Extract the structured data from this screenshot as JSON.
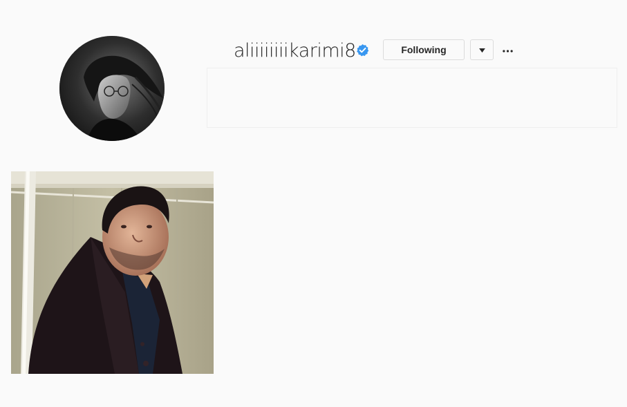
{
  "profile": {
    "username": "aliiiiiiiikarimi8",
    "verified": true,
    "follow_button_label": "Following",
    "dropdown_icon": "caret-down-icon",
    "more_icon": "more-options-icon",
    "verified_badge_color": "#3897f0"
  },
  "colors": {
    "background": "#fafafa",
    "text": "#262626",
    "border": "#dbdbdb"
  },
  "posts": [
    {
      "icon": "post-thumbnail"
    }
  ]
}
